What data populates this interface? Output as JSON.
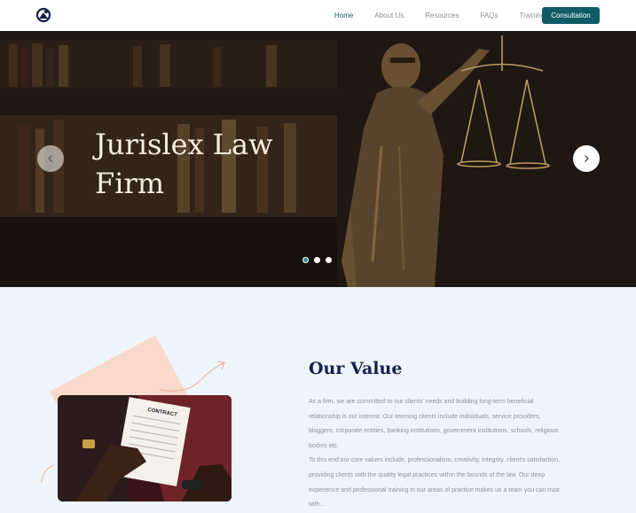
{
  "nav": {
    "links": [
      {
        "label": "Home",
        "active": true
      },
      {
        "label": "About Us",
        "active": false
      },
      {
        "label": "Resources",
        "active": false
      },
      {
        "label": "FAQs",
        "active": false
      },
      {
        "label": "Training",
        "active": false
      }
    ],
    "cta_label": "Consultation"
  },
  "hero": {
    "title_line1": "Jurislex Law",
    "title_line2": "Firm",
    "slide_count": 3,
    "active_slide": 1
  },
  "value": {
    "title": "Our Value",
    "paragraph1": "As a firm, we are committed to our clients' needs and building long-term beneficial relationship is our interest. Our teeming clients include individuals, service providers, bloggers, corporate entities, banking institutions, government institutions, schools, religious bodies etc.",
    "paragraph2": "To this end our core values include, professionalism, creativity, integrity, client's satisfaction, providing clients with the quality legal practices within the bounds of the law. Our deep experience and professional training in our areas of practice makes us a team you can trust with...",
    "image_caption": "CONTRACT"
  },
  "colors": {
    "brand": "#0f5c65",
    "heading": "#15214f",
    "accent_peach": "#f8d9cc",
    "background": "#eef5fa"
  },
  "icons": {
    "logo": "firm-logo-icon",
    "prev": "chevron-left-icon",
    "next": "chevron-right-icon"
  }
}
